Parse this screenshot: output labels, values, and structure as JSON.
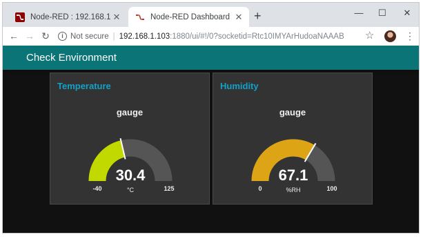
{
  "browser": {
    "tabs": [
      {
        "title": "Node-RED : 192.168.1.103",
        "active": false
      },
      {
        "title": "Node-RED Dashboard",
        "active": true
      }
    ],
    "new_tab": "+",
    "address": {
      "security_text": "Not secure",
      "host": "192.168.1.103",
      "rest": ":1880/ui/#!/0?socketid=Rtc10IMYArHudoaNAAAB"
    }
  },
  "dashboard": {
    "header_title": "Check Environment",
    "header_color": "#0b7476",
    "title_color": "#12a2c8"
  },
  "gauges": [
    {
      "group_title": "Temperature",
      "label": "gauge",
      "value": "30.4",
      "unit": "°C",
      "min": "-40",
      "max": "125",
      "value_num": 30.4,
      "min_num": -40,
      "max_num": 125,
      "fill_color": "#c2d900",
      "track_color": "#555555"
    },
    {
      "group_title": "Humidity",
      "label": "gauge",
      "value": "67.1",
      "unit": "%RH",
      "min": "0",
      "max": "100",
      "value_num": 67.1,
      "min_num": 0,
      "max_num": 100,
      "fill_color": "#dda416",
      "track_color": "#555555"
    }
  ]
}
